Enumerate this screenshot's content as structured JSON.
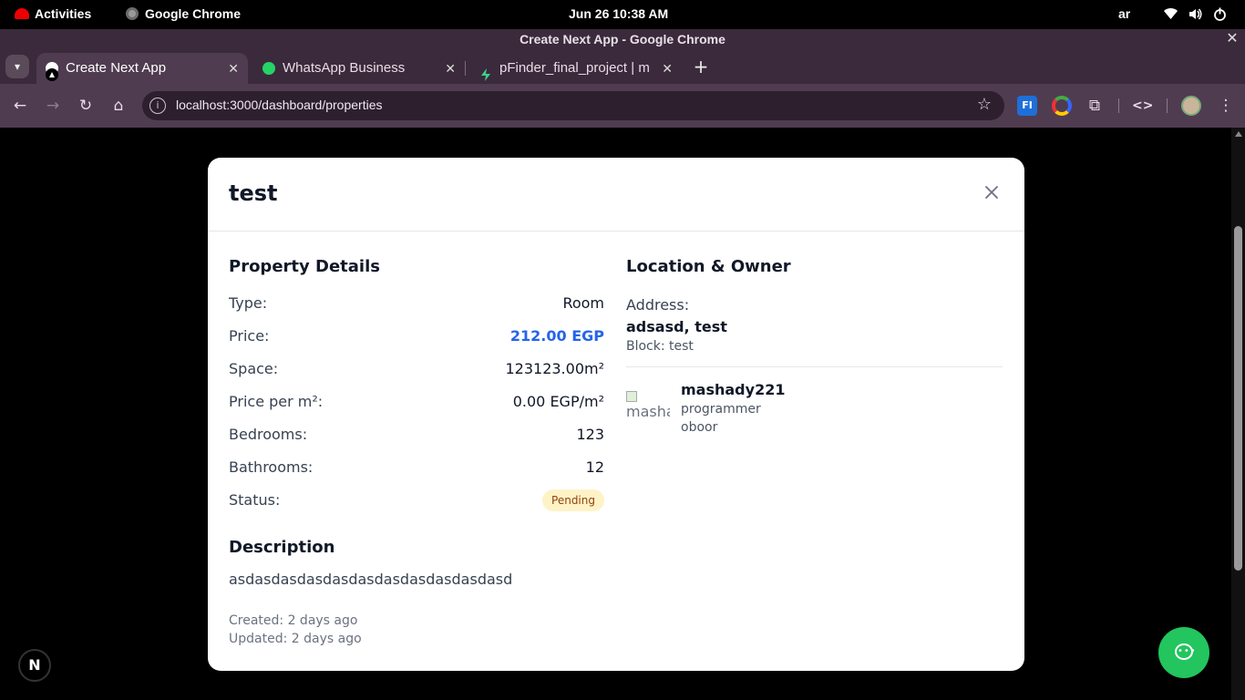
{
  "os_bar": {
    "activities": "Activities",
    "app_name": "Google Chrome",
    "clock": "Jun 26  10:38 AM",
    "language": "ar"
  },
  "window": {
    "title": "Create Next App - Google Chrome"
  },
  "tabs": [
    {
      "label": "Create Next App",
      "icon": "nextjs-icon",
      "active": true
    },
    {
      "label": "WhatsApp Business",
      "icon": "whatsapp-icon",
      "active": false
    },
    {
      "label": "pFinder_final_project | m",
      "icon": "supabase-icon",
      "active": false
    }
  ],
  "toolbar": {
    "url": "localhost:3000/dashboard/properties",
    "ext_fi_label": "FI"
  },
  "modal": {
    "title": "test",
    "property_details": {
      "heading": "Property Details",
      "rows": [
        {
          "label": "Type:",
          "value": "Room"
        },
        {
          "label": "Price:",
          "value": "212.00 EGP"
        },
        {
          "label": "Space:",
          "value": "123123.00m²"
        },
        {
          "label": "Price per m²:",
          "value": "0.00 EGP/m²"
        },
        {
          "label": "Bedrooms:",
          "value": "123"
        },
        {
          "label": "Bathrooms:",
          "value": "12"
        },
        {
          "label": "Status:",
          "value": "Pending"
        }
      ]
    },
    "description": {
      "heading": "Description",
      "text": "asdasdasdasdasdasdasdasdasdasdasd"
    },
    "created": "Created: 2 days ago",
    "updated": "Updated: 2 days ago",
    "location": {
      "heading": "Location & Owner",
      "address_label": "Address:",
      "address": "adsasd, test",
      "block": "Block: test"
    },
    "owner": {
      "image_alt": "mashady221",
      "name": "mashady221",
      "line1": "programmer",
      "line2": "oboor"
    }
  },
  "dev_badge": "N",
  "colors": {
    "price": "#2563eb",
    "pending_bg": "#fef3c7",
    "pending_text": "#92400e",
    "whatsapp": "#22c55e",
    "chrome_frame": "#3b2a3b",
    "chrome_toolbar": "#503c50"
  }
}
